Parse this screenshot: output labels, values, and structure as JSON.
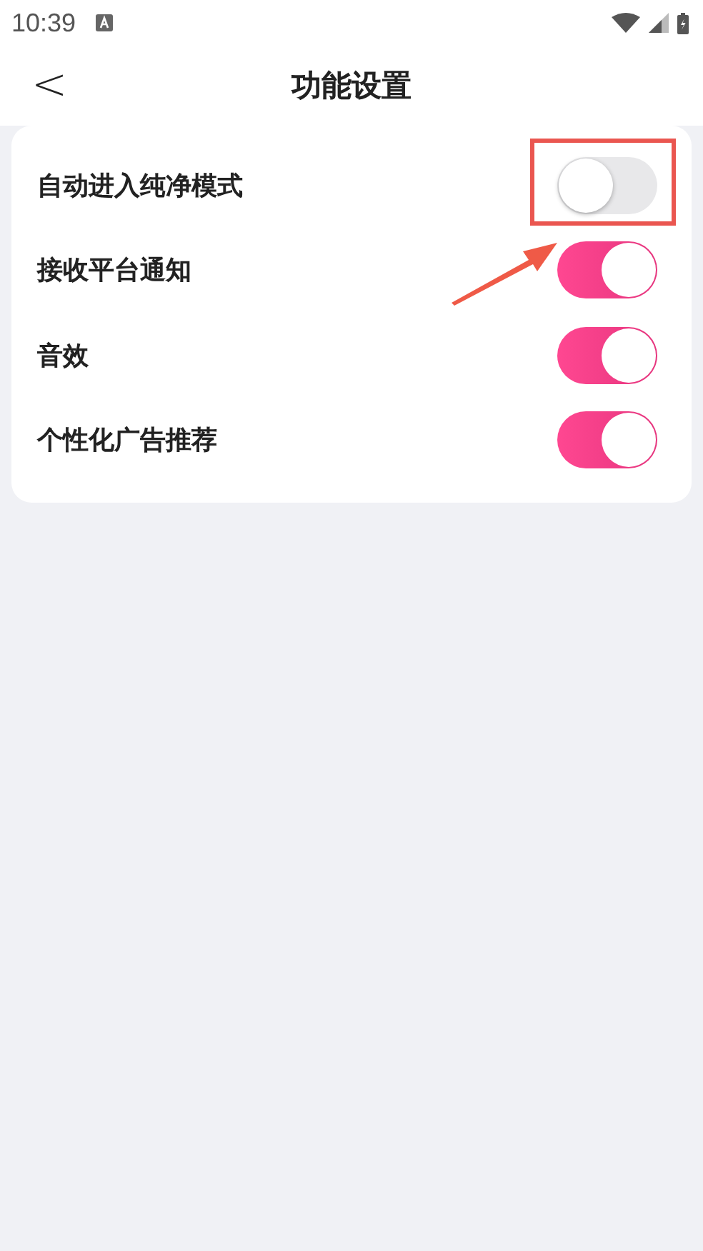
{
  "status_bar": {
    "time": "10:39"
  },
  "header": {
    "back": "<",
    "title": "功能设置"
  },
  "settings": [
    {
      "label": "自动进入纯净模式",
      "on": false,
      "highlighted": true
    },
    {
      "label": "接收平台通知",
      "on": true,
      "highlighted": false
    },
    {
      "label": "音效",
      "on": true,
      "highlighted": false
    },
    {
      "label": "个性化广告推荐",
      "on": true,
      "highlighted": false
    }
  ]
}
